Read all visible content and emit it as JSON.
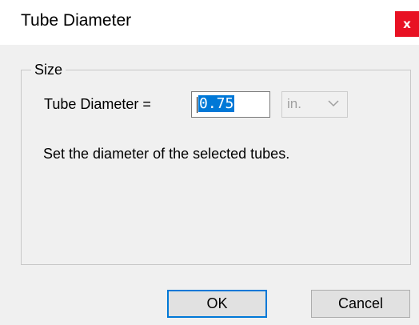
{
  "window": {
    "title": "Tube Diameter",
    "close_label": "x"
  },
  "size_group": {
    "legend": "Size",
    "diameter_label": "Tube Diameter =",
    "diameter_value": "0.75",
    "unit_value": "in.",
    "description": "Set the diameter of the selected tubes."
  },
  "buttons": {
    "ok_label": "OK",
    "cancel_label": "Cancel"
  },
  "colors": {
    "close_button": "#e81123",
    "selection": "#0078d7",
    "dialog_background": "#f0f0f0"
  },
  "icons": {
    "unit_dropdown": "chevron-down-icon"
  }
}
